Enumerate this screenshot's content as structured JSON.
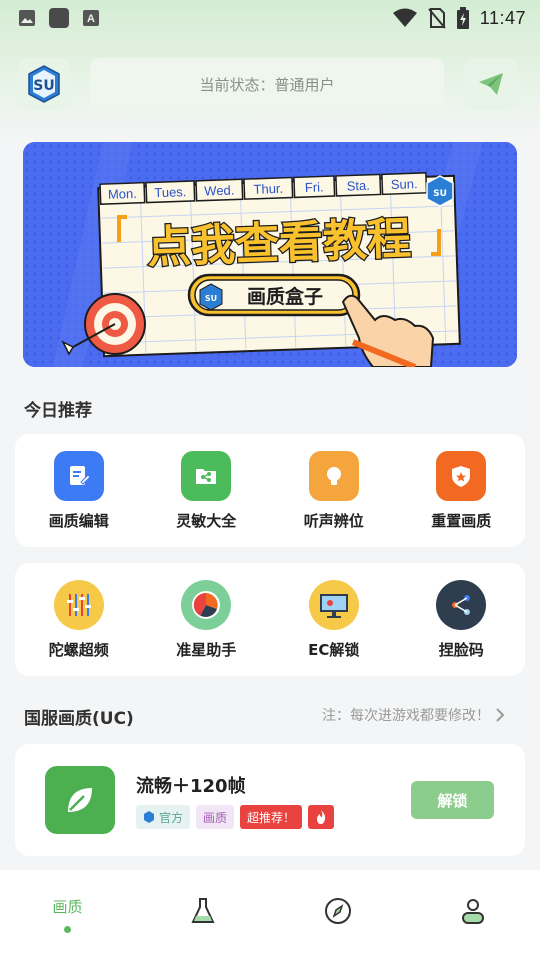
{
  "status_bar": {
    "time": "11:47",
    "left_icons": [
      "image-icon",
      "app-icon",
      "font-icon"
    ],
    "right_icons": [
      "wifi-icon",
      "no-sim-icon",
      "battery-charging-icon"
    ]
  },
  "header": {
    "status_text": "当前状态：普通用户"
  },
  "banner": {
    "days": [
      "Mon.",
      "Tues.",
      "Wed.",
      "Thur.",
      "Fri.",
      "Sta.",
      "Sun."
    ],
    "headline": "点我查看教程",
    "tag_label": "画质盒子"
  },
  "recommend": {
    "title": "今日推荐",
    "row1": [
      {
        "label": "画质编辑",
        "icon": "edit-doc-icon",
        "color": "#3d7bf5"
      },
      {
        "label": "灵敏大全",
        "icon": "share-folder-icon",
        "color": "#4cbb5c"
      },
      {
        "label": "听声辨位",
        "icon": "bulb-icon",
        "color": "#f5a53d"
      },
      {
        "label": "重置画质",
        "icon": "shield-star-icon",
        "color": "#f26a22"
      }
    ],
    "row2": [
      {
        "label": "陀螺超频",
        "icon": "gyro-sliders-icon",
        "color": "#f7c948"
      },
      {
        "label": "准星助手",
        "icon": "pie-chart-icon",
        "color": "#7dcf9a"
      },
      {
        "label": "EC解锁",
        "icon": "monitor-icon",
        "color": "#f7c948"
      },
      {
        "label": "捏脸码",
        "icon": "share-network-icon",
        "color": "#2f3e4f"
      }
    ]
  },
  "guofu": {
    "title": "国服画质(UC)",
    "note": "注：每次进游戏都要修改！"
  },
  "plan": {
    "title": "流畅＋120帧",
    "tags": {
      "official": "官方",
      "quality": "画质",
      "recommend": "超推荐！"
    },
    "unlock": "解锁"
  },
  "bottom_nav": {
    "active_label": "画质",
    "items": [
      "quality-tab",
      "lab-tab",
      "discover-tab",
      "profile-tab"
    ]
  }
}
